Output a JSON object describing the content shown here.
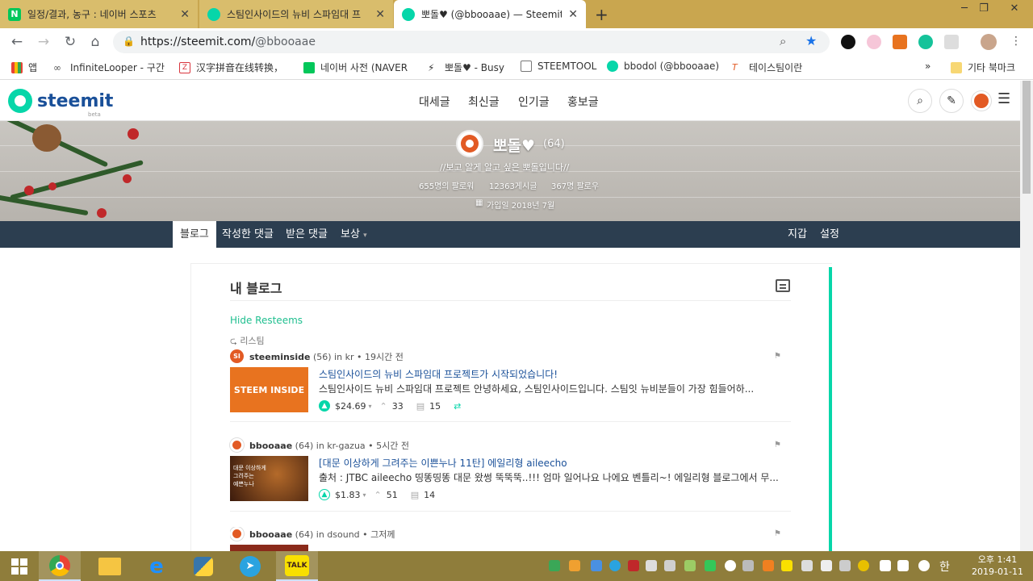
{
  "browser": {
    "tabs": [
      {
        "title": "일정/결과, 농구 : 네이버 스포츠",
        "favicon_color": "#03c75a"
      },
      {
        "title": "스팀인사이드의 뉴비 스파임대 프",
        "favicon_color": "#06d6a9"
      },
      {
        "title": "뽀돌♥ (@bbooaae) — Steemit",
        "favicon_color": "#06d6a9"
      }
    ],
    "new_tab": "+",
    "url_host": "https://steemit.com/",
    "url_path": "@bbooaae",
    "bookmarks": [
      {
        "label": "앱",
        "color": "#e94235"
      },
      {
        "label": "InfiniteLooper - 구간",
        "color": "#555555"
      },
      {
        "label": "汉字拼音在线转换，",
        "color": "#d9363e"
      },
      {
        "label": "네이버 사전 (NAVER",
        "color": "#03c75a"
      },
      {
        "label": "뽀돌♥ - Busy",
        "color": "#222222"
      },
      {
        "label": "STEEMTOOL",
        "color": "#777777"
      },
      {
        "label": "bbodol (@bbooaae)",
        "color": "#06d6a9"
      },
      {
        "label": "테이스팀이란",
        "color": "#e25a24"
      }
    ],
    "more_bookmarks": "»",
    "other_bookmarks": "기타 북마크"
  },
  "steemit": {
    "logo_text": "steemit",
    "logo_beta": "beta",
    "nav": [
      "대세글",
      "최신글",
      "인기글",
      "홍보글"
    ],
    "profile": {
      "name": "뽀돌♥",
      "reputation": "(64)",
      "tagline": "//보고 알게 알고 싶은 뽀돌입니다//",
      "followers": "655명의 팔로워",
      "posts": "12363게시글",
      "following": "367명 팔로우",
      "joined": "가입일 2018년 7월"
    },
    "profile_tabs": [
      "블로그",
      "작성한 댓글",
      "받은 댓글",
      "보상"
    ],
    "reward_caret": "▾",
    "profile_right": [
      "지갑",
      "설정"
    ],
    "content": {
      "heading": "내 블로그",
      "hide_resteems": "Hide Resteems",
      "resteemed_label": "리스팀",
      "posts": [
        {
          "author": "steeminside",
          "rep": "(56)",
          "in": "in",
          "category": "kr",
          "time": "• 19시간 전",
          "avatar_text": "SI",
          "avatar_color": "#e25a24",
          "thumb_text": "STEEM INSIDE",
          "thumb_color": "#e8731f",
          "title": "스팀인사이드의 뉴비 스파임대 프로젝트가 시작되었습니다!",
          "body": "스팀인사이드 뉴비 스파임대 프로젝트 안녕하세요, 스팀인사이드입니다. 스팀잇 뉴비분들이 가장 힘들어하...",
          "payout": "$24.69",
          "votes": "33",
          "comments": "15",
          "resteem_icon": "⇄"
        },
        {
          "author": "bbooaae",
          "rep": "(64)",
          "in": "in",
          "category": "kr-gazua",
          "time": "• 5시간 전",
          "avatar_text": "",
          "avatar_color": "#e25a24",
          "thumb_text": "",
          "thumb_color": "#5a2a14",
          "thumb_caption": "대문 이상하게\n그려주는\n예쁜누나",
          "title": "[대문 이상하게 그려주는 이쁜누나 11탄] 에일리형 aileecho",
          "body": "출처 : JTBC aileecho 띵똥띵똥 대문 왔썽 뚝뚝뚝..!!! 엄마 일어나요 나에요 벤틀리~! 에일리형 블로그에서 무...",
          "payout": "$1.83",
          "votes": "51",
          "comments": "14"
        },
        {
          "author": "bbooaae",
          "rep": "(64)",
          "in": "in",
          "category": "dsound",
          "time": "• 그저께"
        }
      ]
    }
  },
  "taskbar": {
    "clock_time": "오후 1:41",
    "clock_date": "2019-01-11",
    "ime": "한",
    "kakao": "TALK"
  }
}
